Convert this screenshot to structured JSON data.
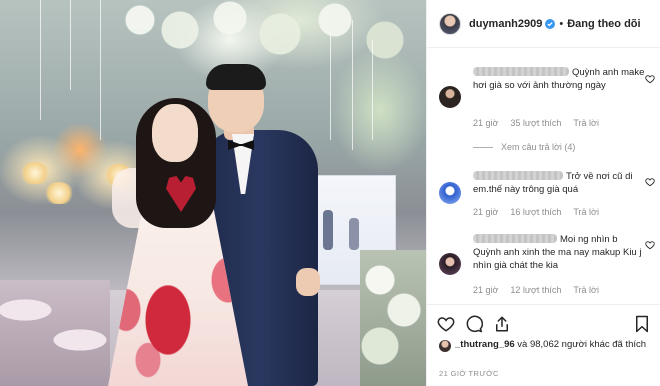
{
  "post_header": {
    "username": "duymanh2909",
    "separator": "•",
    "follow_status": "Đang theo dõi"
  },
  "comments": [
    {
      "author": "▒▒▒▒▒▒▒",
      "text": "Quỳnh anh make hơi già so với ảnh thường ngày",
      "time": "21 giờ",
      "likes": "35 lượt thích",
      "reply": "Trả lời",
      "view_replies": "Xem câu trả lời (4)"
    },
    {
      "author": "▒▒▒▒▒▒▒",
      "text": "Trở về nơi cũ di em.thế này trông già quá",
      "time": "21 giờ",
      "likes": "16 lượt thích",
      "reply": "Trả lời"
    },
    {
      "author": "▒▒▒▒▒▒▒",
      "text": "Moi ng nhìn b Quỳnh anh xinh the ma nay makup Kiu j nhìn già chát the kia",
      "time": "21 giờ",
      "likes": "12 lượt thích",
      "reply": "Trả lời"
    }
  ],
  "likes_summary": {
    "user": "_thutrang_96",
    "rest": " và 98,062 người khác đã thích"
  },
  "timestamp": "21 GIỜ TRƯỚC",
  "icons": {
    "verified": "verified-badge-icon",
    "heart": "heart-outline-icon",
    "comment": "comment-bubble-icon",
    "share": "share-plane-icon",
    "save": "bookmark-icon"
  },
  "colors": {
    "verified": "#3897f0",
    "muted": "#8e8e8e",
    "text": "#262626"
  }
}
